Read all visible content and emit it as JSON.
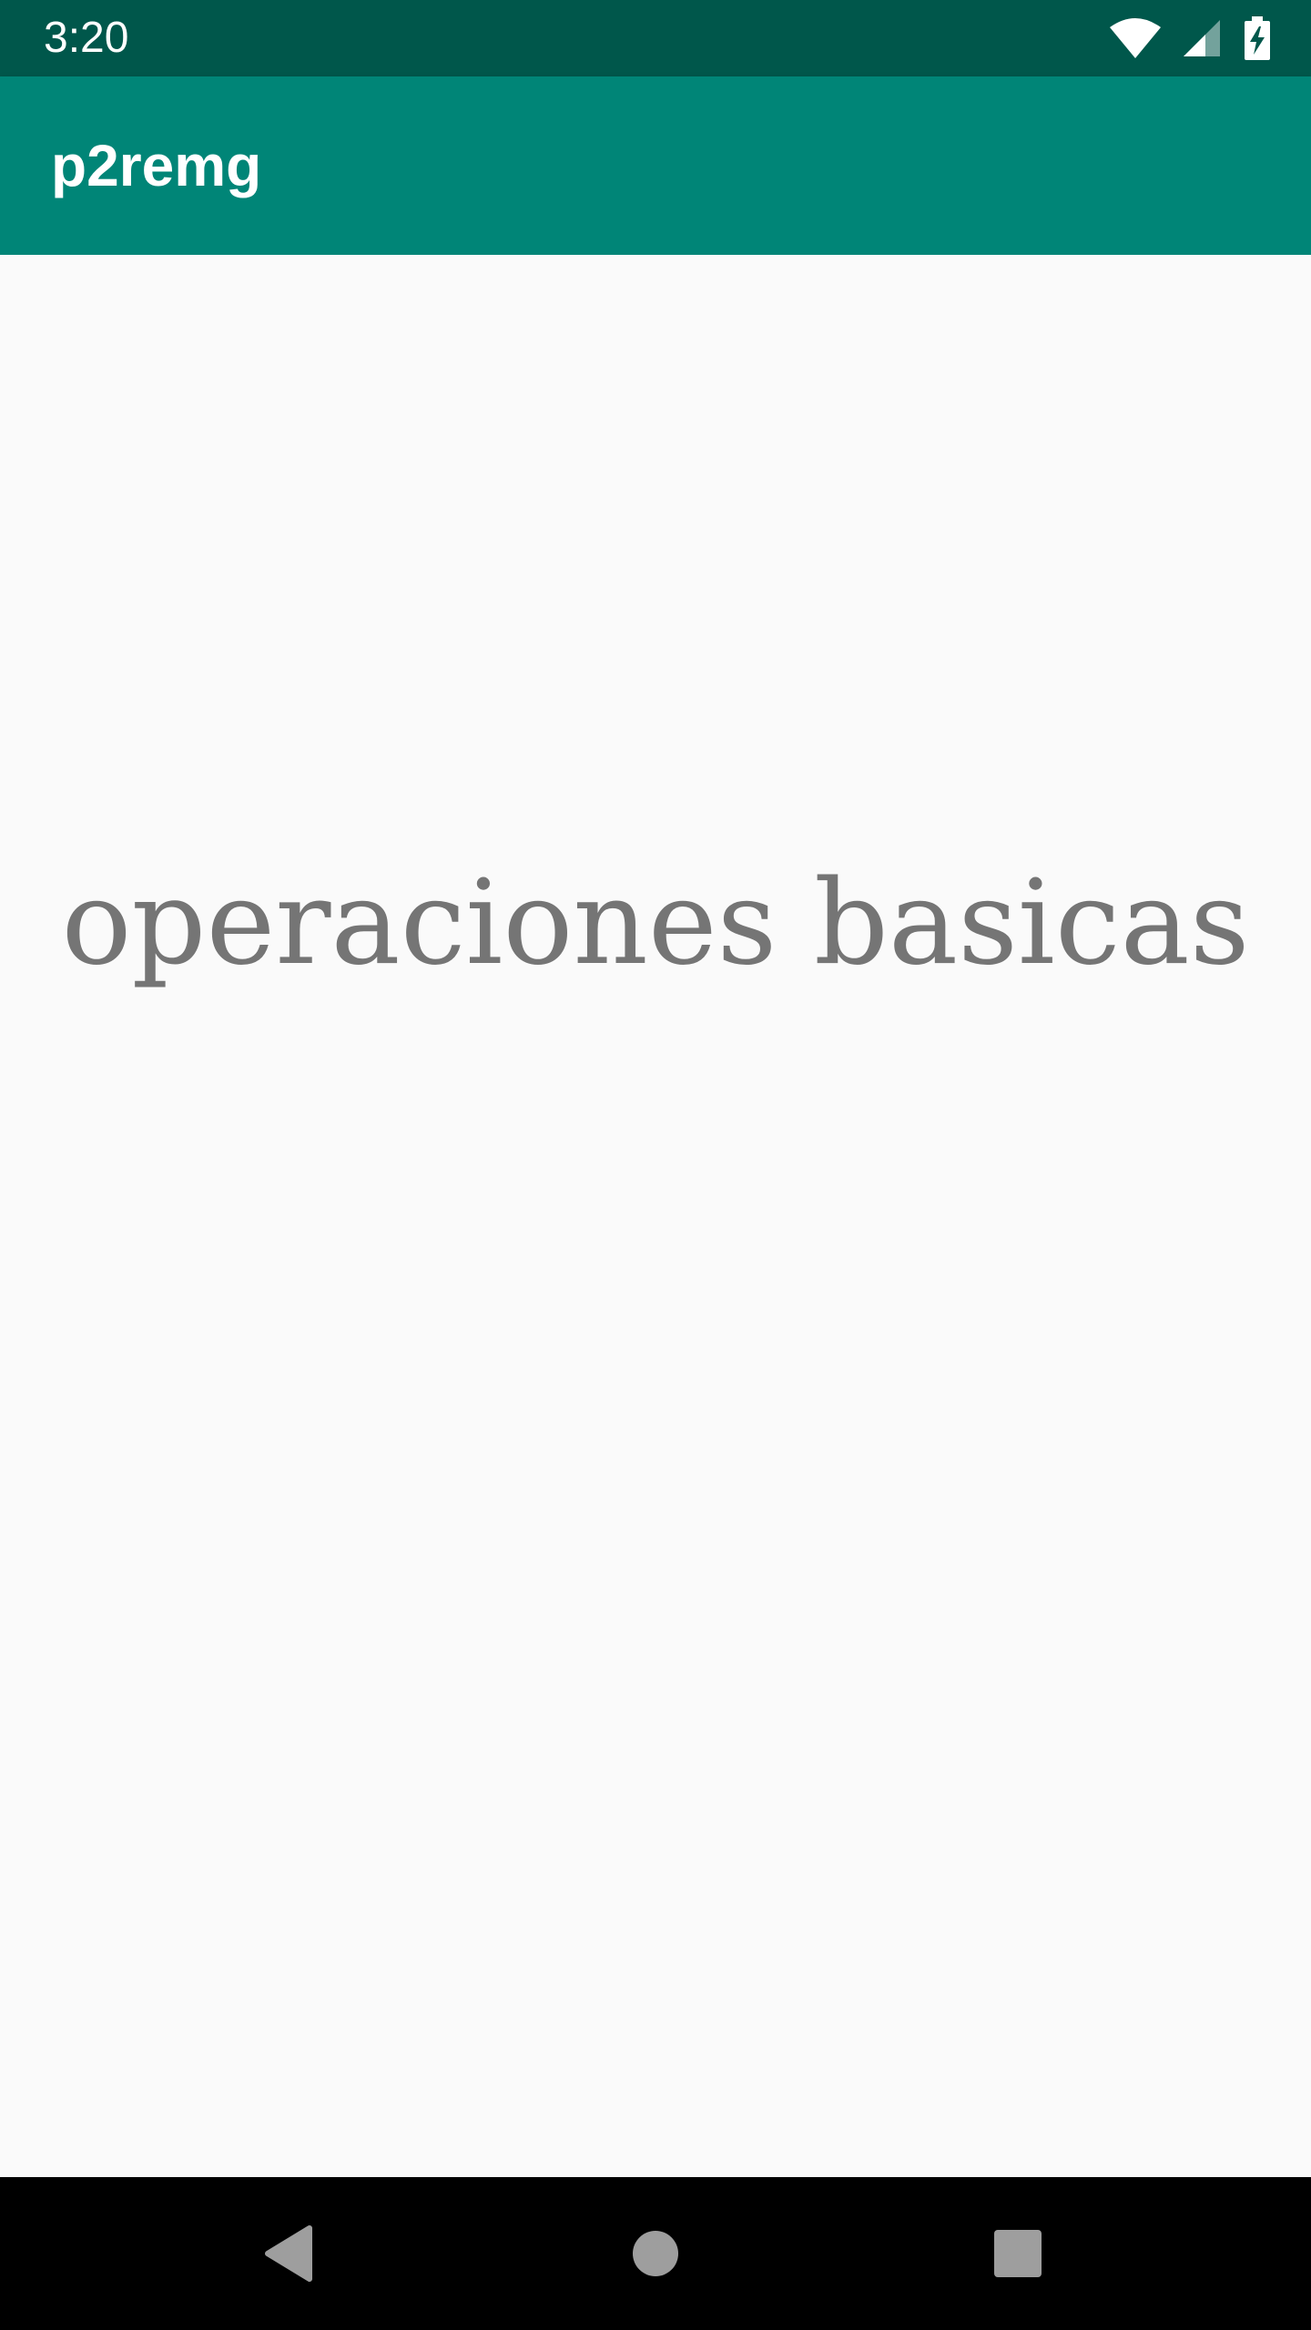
{
  "status_bar": {
    "time": "3:20",
    "icons": [
      "wifi-icon",
      "cellular-signal-icon",
      "battery-charging-icon"
    ],
    "background": "#00574b"
  },
  "app_bar": {
    "title": "p2remg",
    "background": "#008577"
  },
  "main": {
    "text": "operaciones basicas",
    "text_color": "#757575",
    "background": "#fafafa"
  },
  "nav_bar": {
    "buttons": [
      "back-icon",
      "home-icon",
      "recents-icon"
    ]
  }
}
